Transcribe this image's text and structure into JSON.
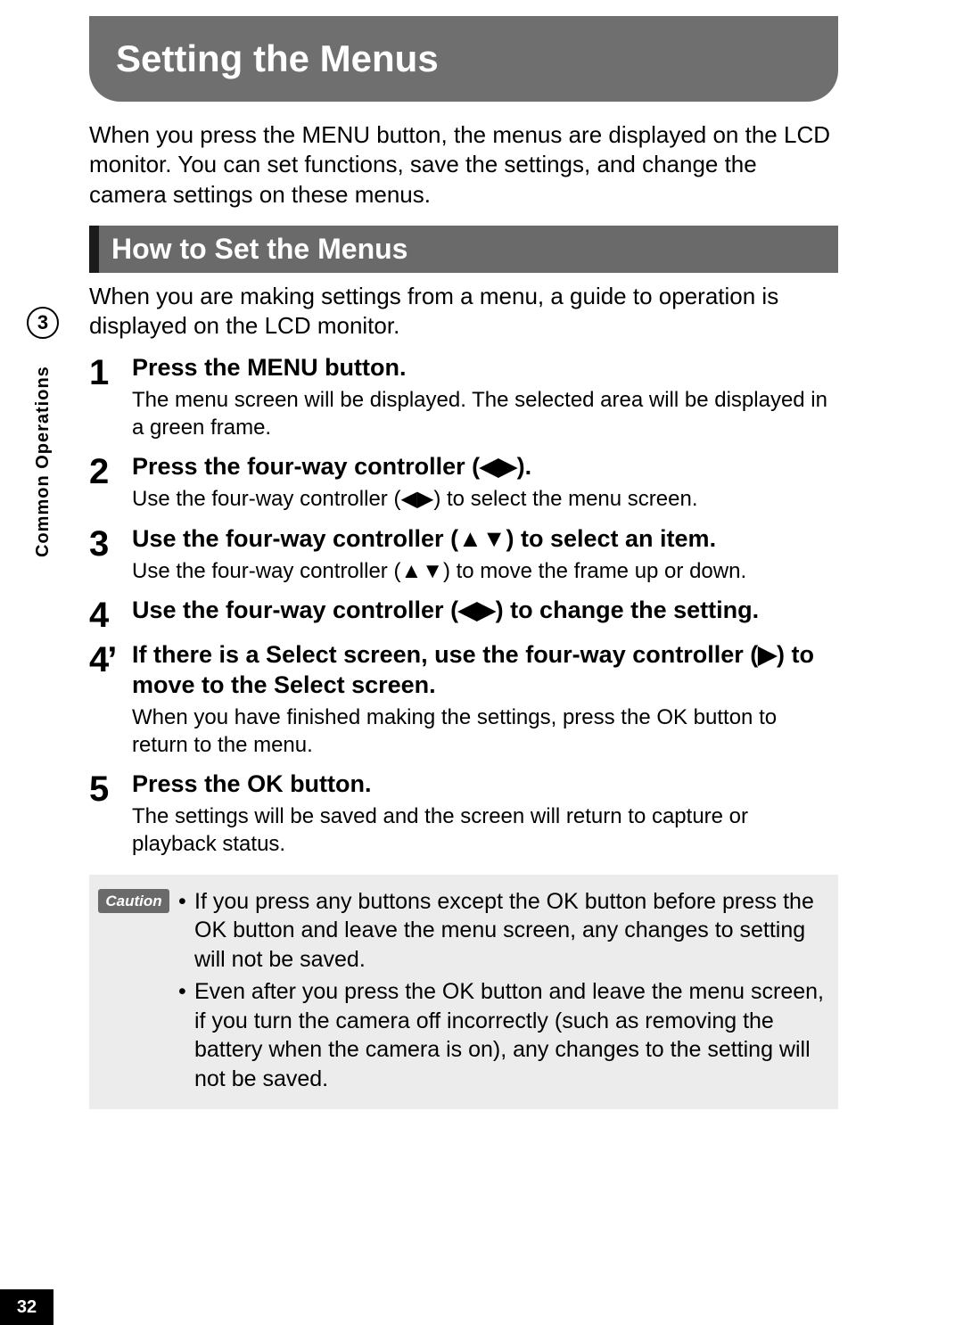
{
  "page_number": "32",
  "chapter": {
    "number": "3",
    "label": "Common Operations"
  },
  "title": "Setting the Menus",
  "lead": "When you press the MENU button, the menus are displayed on the LCD monitor. You can set functions, save the settings, and change the camera settings on these menus.",
  "section_heading": "How to Set the Menus",
  "section_lead": "When you are making settings from a menu, a guide to operation is displayed on the LCD monitor.",
  "steps": [
    {
      "num": "1",
      "title": "Press the MENU button.",
      "desc": "The menu screen will be displayed. The selected area will be displayed in a green frame."
    },
    {
      "num": "2",
      "title": "Press the four-way controller (◀▶).",
      "desc": "Use the four-way controller (◀▶) to select the menu screen."
    },
    {
      "num": "3",
      "title": "Use the four-way controller (▲▼) to select an item.",
      "desc": "Use the four-way controller (▲▼) to move the frame up or down."
    },
    {
      "num": "4",
      "title": "Use the four-way controller (◀▶) to change the setting.",
      "desc": ""
    },
    {
      "num": "4’",
      "title": "If there is a Select screen, use the four-way controller (▶) to move to the Select screen.",
      "desc": "When you have finished making the settings, press the OK button to return to the menu."
    },
    {
      "num": "5",
      "title": "Press the OK button.",
      "desc": "The settings will be saved and the screen will return to capture or playback status."
    }
  ],
  "caution_label": "Caution",
  "cautions": [
    "If you press any buttons except the OK button before press the OK button and leave the menu screen, any changes to setting will not be saved.",
    "Even after you press the OK button and leave the menu screen, if you turn the camera off incorrectly (such as removing the battery when the camera is on), any changes to the setting will not be saved."
  ]
}
